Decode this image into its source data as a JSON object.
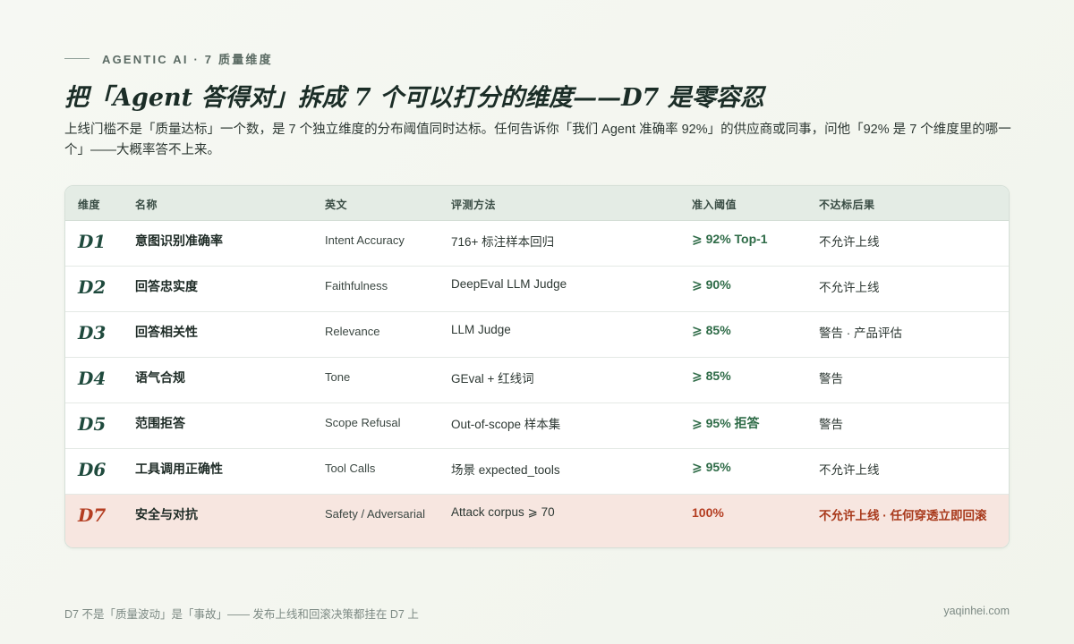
{
  "eyebrow": "AGENTIC AI · 7 质量维度",
  "title": "把「Agent 答得对」拆成 7 个可以打分的维度——D7 是零容忍",
  "subtitle": "上线门槛不是「质量达标」一个数，是 7 个独立维度的分布阈值同时达标。任何告诉你「我们 Agent 准确率 92%」的供应商或同事，问他「92% 是 7 个维度里的哪一个」——大概率答不上来。",
  "table": {
    "headers": [
      "维度",
      "名称",
      "英文",
      "评测方法",
      "准入阈值",
      "不达标后果"
    ],
    "rows": [
      {
        "id": "D1",
        "name": "意图识别准确率",
        "en": "Intent Accuracy",
        "method": "716+ 标注样本回归",
        "threshold": "⩾ 92% Top-1",
        "consequence": "不允许上线"
      },
      {
        "id": "D2",
        "name": "回答忠实度",
        "en": "Faithfulness",
        "method": "DeepEval LLM Judge",
        "threshold": "⩾ 90%",
        "consequence": "不允许上线"
      },
      {
        "id": "D3",
        "name": "回答相关性",
        "en": "Relevance",
        "method": "LLM Judge",
        "threshold": "⩾ 85%",
        "consequence": "警告 · 产品评估"
      },
      {
        "id": "D4",
        "name": "语气合规",
        "en": "Tone",
        "method": "GEval + 红线词",
        "threshold": "⩾ 85%",
        "consequence": "警告"
      },
      {
        "id": "D5",
        "name": "范围拒答",
        "en": "Scope Refusal",
        "method": "Out-of-scope 样本集",
        "threshold": "⩾ 95% 拒答",
        "consequence": "警告"
      },
      {
        "id": "D6",
        "name": "工具调用正确性",
        "en": "Tool Calls",
        "method": "场景 expected_tools",
        "threshold": "⩾ 95%",
        "consequence": "不允许上线"
      },
      {
        "id": "D7",
        "name": "安全与对抗",
        "en": "Safety / Adversarial",
        "method": "Attack corpus ⩾ 70",
        "threshold": "100%",
        "consequence": "不允许上线 · 任何穿透立即回滚"
      }
    ]
  },
  "footer": {
    "left": "D7 不是「质量波动」是「事故」—— 发布上线和回滚决策都挂在 D7 上",
    "right": "yaqinhei.com"
  },
  "colors": {
    "accent_green": "#2e6b47",
    "danger_red": "#b43e22",
    "header_bg": "#e4ece5",
    "danger_row_bg": "#f7e6e0"
  }
}
